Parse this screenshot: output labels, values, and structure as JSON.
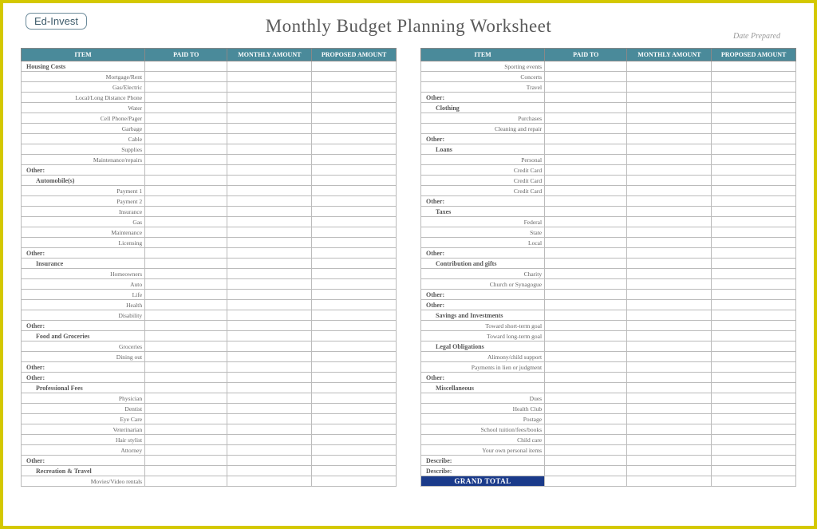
{
  "logo": {
    "part1": "Ed",
    "dash": "-",
    "part2": "Invest"
  },
  "title": "Monthly Budget Planning Worksheet",
  "date_prepared_label": "Date Prepared",
  "headers": {
    "item": "ITEM",
    "paid_to": "PAID TO",
    "monthly": "MONTHLY AMOUNT",
    "proposed": "PROPOSED AMOUNT"
  },
  "grand_total": "GRAND TOTAL",
  "left_rows": [
    {
      "t": "section",
      "v": "Housing Costs"
    },
    {
      "t": "item",
      "v": "Mortgage/Rent"
    },
    {
      "t": "item",
      "v": "Gas/Electric"
    },
    {
      "t": "item",
      "v": "Local/Long Distance Phone"
    },
    {
      "t": "item",
      "v": "Water"
    },
    {
      "t": "item",
      "v": "Cell Phone/Pager"
    },
    {
      "t": "item",
      "v": "Garbage"
    },
    {
      "t": "item",
      "v": "Cable"
    },
    {
      "t": "item",
      "v": "Supplies"
    },
    {
      "t": "item",
      "v": "Maintenance/repairs"
    },
    {
      "t": "section",
      "v": "Other:"
    },
    {
      "t": "subsection",
      "v": "Automobile(s)"
    },
    {
      "t": "item",
      "v": "Payment 1"
    },
    {
      "t": "item",
      "v": "Payment 2"
    },
    {
      "t": "item",
      "v": "Insurance"
    },
    {
      "t": "item",
      "v": "Gas"
    },
    {
      "t": "item",
      "v": "Maintenance"
    },
    {
      "t": "item",
      "v": "Licensing"
    },
    {
      "t": "section",
      "v": "Other:"
    },
    {
      "t": "subsection",
      "v": "Insurance"
    },
    {
      "t": "item",
      "v": "Homeowners"
    },
    {
      "t": "item",
      "v": "Auto"
    },
    {
      "t": "item",
      "v": "Life"
    },
    {
      "t": "item",
      "v": "Health"
    },
    {
      "t": "item",
      "v": "Disability"
    },
    {
      "t": "section",
      "v": "Other:"
    },
    {
      "t": "subsection",
      "v": "Food and Groceries"
    },
    {
      "t": "item",
      "v": "Groceries"
    },
    {
      "t": "item",
      "v": "Dining out"
    },
    {
      "t": "section",
      "v": "Other:"
    },
    {
      "t": "section",
      "v": "Other:"
    },
    {
      "t": "subsection",
      "v": "Professional Fees"
    },
    {
      "t": "item",
      "v": "Physician"
    },
    {
      "t": "item",
      "v": "Dentist"
    },
    {
      "t": "item",
      "v": "Eye Care"
    },
    {
      "t": "item",
      "v": "Veterinarian"
    },
    {
      "t": "item",
      "v": "Hair stylist"
    },
    {
      "t": "item",
      "v": "Attorney"
    },
    {
      "t": "section",
      "v": "Other:"
    },
    {
      "t": "subsection",
      "v": "Recreation & Travel"
    },
    {
      "t": "item",
      "v": "Movies/Video rentals"
    }
  ],
  "right_rows": [
    {
      "t": "item",
      "v": "Sporting events"
    },
    {
      "t": "item",
      "v": "Concerts"
    },
    {
      "t": "item",
      "v": "Travel"
    },
    {
      "t": "section",
      "v": "Other:"
    },
    {
      "t": "subsection",
      "v": "Clothing"
    },
    {
      "t": "item",
      "v": "Purchases"
    },
    {
      "t": "item",
      "v": "Cleaning and repair"
    },
    {
      "t": "section",
      "v": "Other:"
    },
    {
      "t": "subsection",
      "v": "Loans"
    },
    {
      "t": "item",
      "v": "Personal"
    },
    {
      "t": "item",
      "v": "Credit Card"
    },
    {
      "t": "item",
      "v": "Credit Card"
    },
    {
      "t": "item",
      "v": "Credit Card"
    },
    {
      "t": "section",
      "v": "Other:"
    },
    {
      "t": "subsection",
      "v": "Taxes"
    },
    {
      "t": "item",
      "v": "Federal"
    },
    {
      "t": "item",
      "v": "State"
    },
    {
      "t": "item",
      "v": "Local"
    },
    {
      "t": "section",
      "v": "Other:"
    },
    {
      "t": "subsection",
      "v": "Contribution and gifts"
    },
    {
      "t": "item",
      "v": "Charity"
    },
    {
      "t": "item",
      "v": "Church or Synagogue"
    },
    {
      "t": "section",
      "v": "Other:"
    },
    {
      "t": "section",
      "v": "Other:"
    },
    {
      "t": "subsection",
      "v": "Savings and Investments"
    },
    {
      "t": "item",
      "v": "Toward short-term goal"
    },
    {
      "t": "item",
      "v": "Toward long-term goal"
    },
    {
      "t": "subsection",
      "v": "Legal Obligations"
    },
    {
      "t": "item",
      "v": "Alimony/child support"
    },
    {
      "t": "item",
      "v": "Payments in lien or judgment"
    },
    {
      "t": "section",
      "v": "Other:"
    },
    {
      "t": "subsection",
      "v": "Miscellaneous"
    },
    {
      "t": "item",
      "v": "Dues"
    },
    {
      "t": "item",
      "v": "Health Club"
    },
    {
      "t": "item",
      "v": "Postage"
    },
    {
      "t": "item",
      "v": "School tuition/fees/books"
    },
    {
      "t": "item",
      "v": "Child care"
    },
    {
      "t": "item",
      "v": "Your own personal items"
    },
    {
      "t": "section",
      "v": "Describe:"
    },
    {
      "t": "section",
      "v": "Describe:"
    }
  ]
}
